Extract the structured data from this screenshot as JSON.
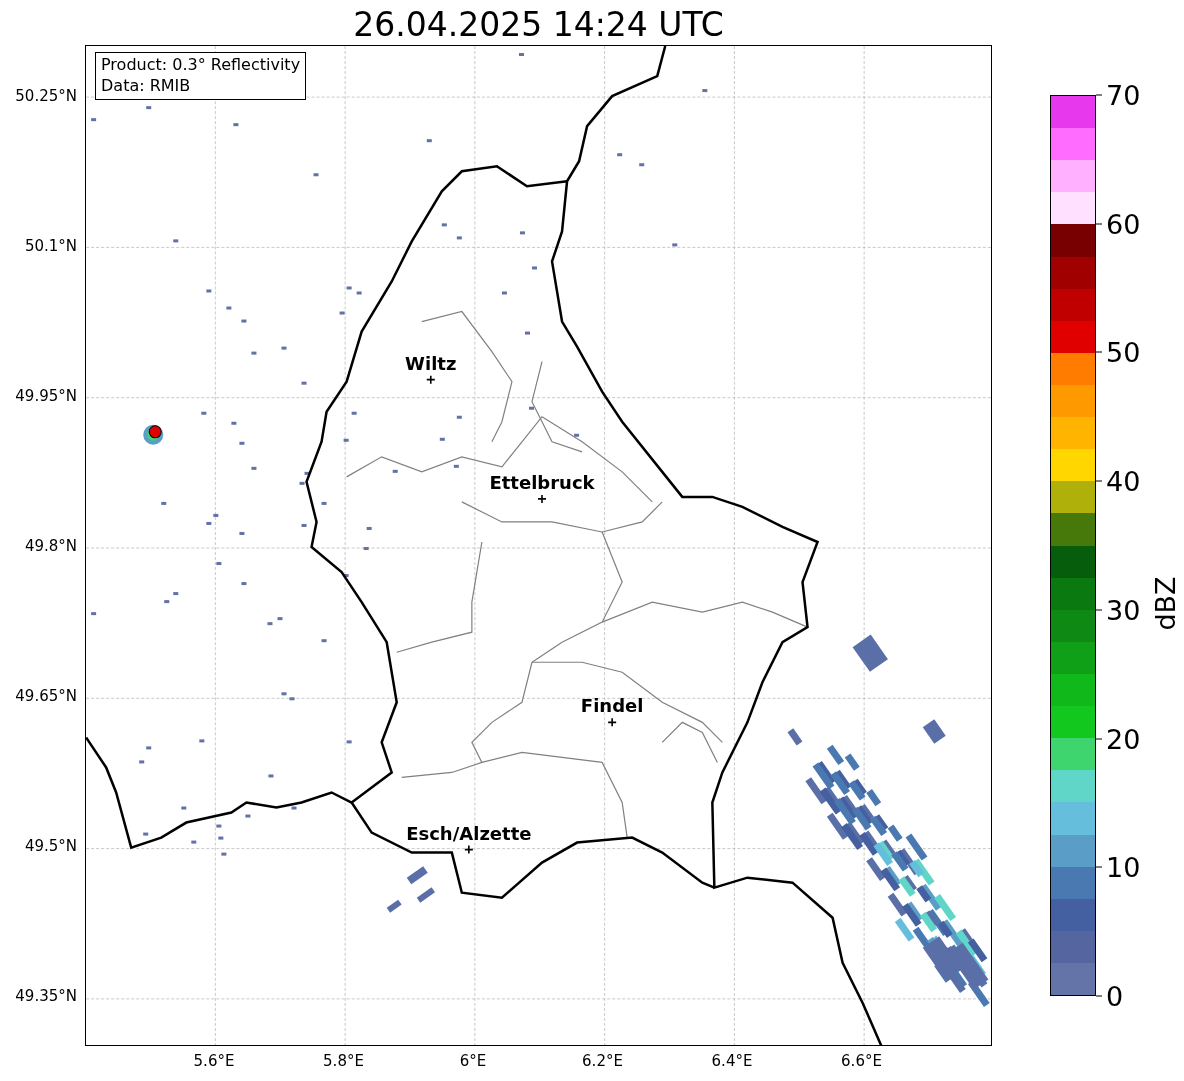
{
  "title": "26.04.2025 14:24 UTC",
  "info_box": {
    "lines": [
      "Product: 0.3° Reflectivity",
      "Data: RMIB"
    ]
  },
  "map": {
    "lat_ticks": [
      "50.25°N",
      "50.1°N",
      "49.95°N",
      "49.8°N",
      "49.65°N",
      "49.5°N",
      "49.35°N"
    ],
    "lon_ticks": [
      "5.6°E",
      "5.8°E",
      "6°E",
      "6.2°E",
      "6.4°E",
      "6.6°E"
    ],
    "cities": [
      {
        "name": "Wiltz"
      },
      {
        "name": "Ettelbruck"
      },
      {
        "name": "Findel"
      },
      {
        "name": "Esch/Alzette"
      }
    ]
  },
  "colorbar": {
    "label": "dBZ",
    "ticks": [
      "70",
      "60",
      "50",
      "40",
      "30",
      "20",
      "10",
      "0"
    ],
    "segments": [
      {
        "color": "#e838ee"
      },
      {
        "color": "#ff6cff"
      },
      {
        "color": "#ffb0ff"
      },
      {
        "color": "#ffe0ff"
      },
      {
        "color": "#780000"
      },
      {
        "color": "#a00000"
      },
      {
        "color": "#c00000"
      },
      {
        "color": "#e00000"
      },
      {
        "color": "#ff7c00"
      },
      {
        "color": "#ff9900"
      },
      {
        "color": "#ffb400"
      },
      {
        "color": "#ffd600"
      },
      {
        "color": "#b0b00a"
      },
      {
        "color": "#46780a"
      },
      {
        "color": "#065e0c"
      },
      {
        "color": "#0a7a10"
      },
      {
        "color": "#0e8a14"
      },
      {
        "color": "#10a018"
      },
      {
        "color": "#10b81a"
      },
      {
        "color": "#12c81e"
      },
      {
        "color": "#3ed46e"
      },
      {
        "color": "#5fd6c8"
      },
      {
        "color": "#64bedc"
      },
      {
        "color": "#5a9ec8"
      },
      {
        "color": "#4a78b0"
      },
      {
        "color": "#4560a0"
      },
      {
        "color": "#5465a0"
      },
      {
        "color": "#6574a8"
      }
    ]
  }
}
